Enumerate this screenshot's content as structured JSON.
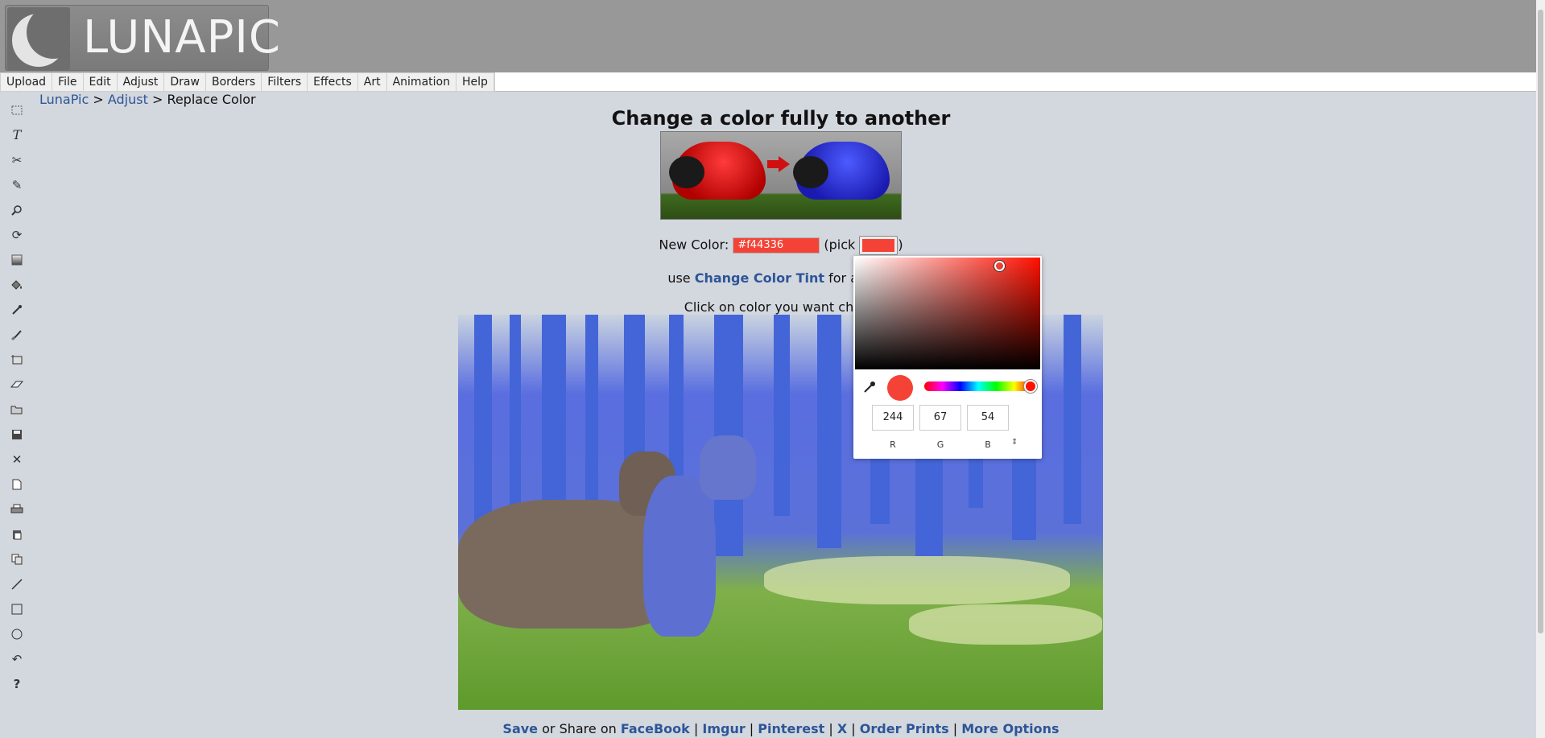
{
  "logo": {
    "text": "LUNAPIC"
  },
  "menu": [
    "Upload",
    "File",
    "Edit",
    "Adjust",
    "Draw",
    "Borders",
    "Filters",
    "Effects",
    "Art",
    "Animation",
    "Help"
  ],
  "breadcrumb": {
    "home": "LunaPic",
    "sep1": " > ",
    "section": "Adjust",
    "sep2": " > ",
    "current": "Replace Color"
  },
  "page": {
    "title": "Change a color fully to another",
    "new_color_label": "New Color:",
    "new_color_value": "#f44336",
    "pick_open": "(pick",
    "pick_close": ")",
    "tint_prefix": "use ",
    "tint_link": "Change Color Tint",
    "tint_suffix": " for a softe",
    "click_instruction": "Click on color you want chang"
  },
  "picker": {
    "r": "244",
    "g": "67",
    "b": "54",
    "r_label": "R",
    "g_label": "G",
    "b_label": "B",
    "current_color": "#f44336"
  },
  "footer": {
    "save": "Save",
    "share_text": " or Share on ",
    "facebook": "FaceBook",
    "sep": " | ",
    "imgur": "Imgur",
    "pinterest": "Pinterest",
    "x": "X",
    "prints": "Order Prints",
    "more": "More Options"
  },
  "tools": [
    "select-icon",
    "text-icon",
    "scissors-icon",
    "pencil-icon",
    "zoom-icon",
    "rotate-icon",
    "gradient-icon",
    "paint-bucket-icon",
    "eyedropper-icon",
    "brush-icon",
    "crop-icon",
    "eraser-icon",
    "open-icon",
    "save-icon",
    "close-icon",
    "new-file-icon",
    "print-icon",
    "paste-icon",
    "copy-icon",
    "line-icon",
    "rectangle-icon",
    "circle-icon",
    "undo-icon",
    "help-icon"
  ]
}
